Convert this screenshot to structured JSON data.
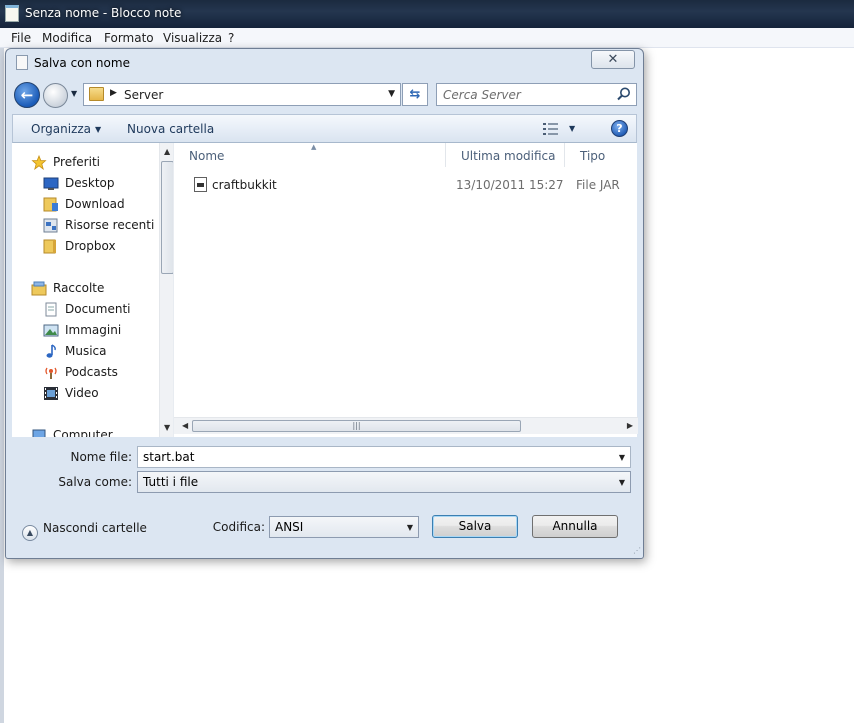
{
  "notepad": {
    "title": "Senza nome - Blocco note",
    "menu": [
      "File",
      "Modifica",
      "Formato",
      "Visualizza",
      "?"
    ]
  },
  "dialog": {
    "title": "Salva con nome",
    "close_glyph": "✕",
    "address": {
      "path": "Server"
    },
    "search": {
      "placeholder": "Cerca Server"
    },
    "toolbar": {
      "organize": "Organizza",
      "new_folder": "Nuova cartella"
    },
    "nav": {
      "favorites_header": "Preferiti",
      "favorites": [
        "Desktop",
        "Download",
        "Risorse recenti",
        "Dropbox"
      ],
      "libraries_header": "Raccolte",
      "libraries": [
        "Documenti",
        "Immagini",
        "Musica",
        "Podcasts",
        "Video"
      ],
      "computer_partial": "Computer"
    },
    "columns": {
      "name": "Nome",
      "modified": "Ultima modifica",
      "type": "Tipo"
    },
    "files": [
      {
        "name": "craftbukkit",
        "modified": "13/10/2011 15:27",
        "type": "File JAR",
        "icon": "jar-file-icon"
      }
    ],
    "form": {
      "filename_label": "Nome file:",
      "filename_value": "start.bat",
      "savetype_label": "Salva come:",
      "savetype_value": "Tutti i file",
      "encoding_label": "Codifica:",
      "encoding_value": "ANSI"
    },
    "hide_folders": "Nascondi cartelle",
    "buttons": {
      "save": "Salva",
      "cancel": "Annulla"
    }
  },
  "colors": {
    "dialog_bg": "#dce6f2",
    "toolbar_text": "#1e395b",
    "header_text": "#4c607a",
    "accent_blue": "#1a5bb8"
  }
}
